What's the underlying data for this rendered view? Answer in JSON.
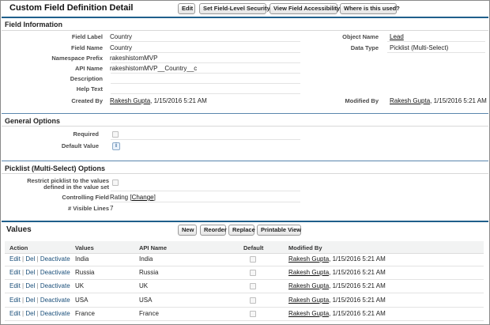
{
  "header": {
    "title": "Custom Field Definition Detail",
    "buttons": [
      "Edit",
      "Set Field-Level Security",
      "View Field Accessibility",
      "Where is this used?"
    ]
  },
  "field_information": {
    "heading": "Field Information",
    "field_label_lbl": "Field Label",
    "field_label_val": "Country",
    "field_name_lbl": "Field Name",
    "field_name_val": "Country",
    "namespace_lbl": "Namespace Prefix",
    "namespace_val": "rakeshistomMVP",
    "api_name_lbl": "API Name",
    "api_name_val": "rakeshistomMVP__Country__c",
    "description_lbl": "Description",
    "help_text_lbl": "Help Text",
    "created_by_lbl": "Created By",
    "created_by_user": "Rakesh Gupta",
    "created_by_date": ", 1/15/2016 5:21 AM",
    "object_name_lbl": "Object Name",
    "object_name_val": "Lead",
    "data_type_lbl": "Data Type",
    "data_type_val": "Picklist (Multi-Select)",
    "modified_by_lbl": "Modified By",
    "modified_by_user": "Rakesh Gupta",
    "modified_by_date": ", 1/15/2016 5:21 AM"
  },
  "general_options": {
    "heading": "General Options",
    "required_lbl": "Required",
    "default_value_lbl": "Default Value",
    "info_icon": "i"
  },
  "picklist_options": {
    "heading": "Picklist (Multi-Select) Options",
    "restrict_lbl_1": "Restrict picklist to the values",
    "restrict_lbl_2": "defined in the value set",
    "controlling_lbl": "Controlling Field",
    "controlling_val": "Rating",
    "change_link": "Change",
    "visible_lines_lbl": "# Visible Lines",
    "visible_lines_val": "7"
  },
  "values": {
    "heading": "Values",
    "buttons": [
      "New",
      "Reorder",
      "Replace",
      "Printable View"
    ],
    "columns": [
      "Action",
      "Values",
      "API Name",
      "Default",
      "Modified By"
    ],
    "actions": [
      "Edit",
      "Del",
      "Deactivate"
    ],
    "rows": [
      {
        "value": "India",
        "api": "India",
        "user": "Rakesh Gupta",
        "date": ", 1/15/2016 5:21 AM"
      },
      {
        "value": "Russia",
        "api": "Russia",
        "user": "Rakesh Gupta",
        "date": ", 1/15/2016 5:21 AM"
      },
      {
        "value": "UK",
        "api": "UK",
        "user": "Rakesh Gupta",
        "date": ", 1/15/2016 5:21 AM"
      },
      {
        "value": "USA",
        "api": "USA",
        "user": "Rakesh Gupta",
        "date": ", 1/15/2016 5:21 AM"
      },
      {
        "value": "France",
        "api": "France",
        "user": "Rakesh Gupta",
        "date": ", 1/15/2016 5:21 AM"
      }
    ]
  }
}
